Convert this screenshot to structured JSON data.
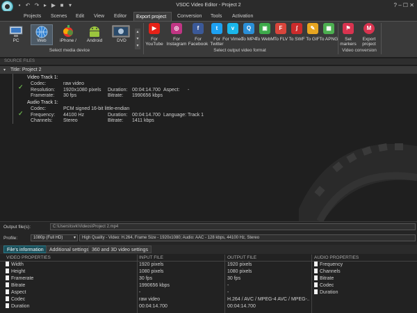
{
  "app": {
    "title": "VSDC Video Editor - Project 2",
    "window_controls": "?  –  ☐  ✕"
  },
  "menu": [
    {
      "label": "Projects"
    },
    {
      "label": "Scenes"
    },
    {
      "label": "Edit"
    },
    {
      "label": "View"
    },
    {
      "label": "Editor"
    },
    {
      "label": "Export project"
    },
    {
      "label": "Conversion"
    },
    {
      "label": "Tools"
    },
    {
      "label": "Activation"
    }
  ],
  "devices": [
    {
      "label": "PC",
      "icon": "pc-icon"
    },
    {
      "label": "Web",
      "icon": "globe-icon"
    },
    {
      "label": "iPhone /",
      "icon": "apple-icon"
    },
    {
      "label": "Android",
      "icon": "android-icon"
    },
    {
      "label": "DVD",
      "icon": "dvd-icon"
    }
  ],
  "device_group_label": "Select media device",
  "formats": [
    {
      "label": "For YouTube",
      "icon": "youtube-icon",
      "color": "#e62117",
      "glyph": "▶"
    },
    {
      "label": "For Instagram",
      "icon": "instagram-icon",
      "color": "#c13584",
      "glyph": "◎"
    },
    {
      "label": "For Facebook",
      "icon": "facebook-icon",
      "color": "#3b5998",
      "glyph": "f"
    },
    {
      "label": "For Twitter",
      "icon": "twitter-icon",
      "color": "#1da1f2",
      "glyph": "t"
    },
    {
      "label": "For Vimeo",
      "icon": "vimeo-icon",
      "color": "#1ab7ea",
      "glyph": "v"
    },
    {
      "label": "To MP4",
      "icon": "mp4-icon",
      "color": "#2a8fd8",
      "glyph": "Q"
    },
    {
      "label": "To WebM",
      "icon": "webm-icon",
      "color": "#3daa4a",
      "glyph": "▣"
    },
    {
      "label": "To FLV",
      "icon": "flv-icon",
      "color": "#d9453b",
      "glyph": "F"
    },
    {
      "label": "To SWF",
      "icon": "swf-icon",
      "color": "#cc2b2b",
      "glyph": "ʃ"
    },
    {
      "label": "To GIF",
      "icon": "gif-icon",
      "color": "#e6a521",
      "glyph": "✎"
    },
    {
      "label": "To APNG",
      "icon": "apng-icon",
      "color": "#4caf50",
      "glyph": "▦"
    }
  ],
  "format_group_label": "Select output video format",
  "conversion": [
    {
      "label": "Set markers",
      "icon": "flag-icon",
      "color": "#d9334f",
      "glyph": "⚑"
    },
    {
      "label": "Export project",
      "icon": "export-icon",
      "color": "#d9334f",
      "glyph": "M"
    }
  ],
  "conversion_group_label": "Video conversion",
  "source": {
    "header": "SOURCE FILES",
    "root": "Title: Project 2",
    "video_track_title": "Video Track 1:",
    "audio_track_title": "Audio Track 1:",
    "video": {
      "codec_label": "Codec:",
      "codec": "raw video",
      "resolution_label": "Resolution:",
      "resolution": "1920x1080 pixels",
      "framerate_label": "Framerate:",
      "framerate": "30 fps",
      "duration_label": "Duration:",
      "duration": "00:04:14.700",
      "bitrate_label": "Bitrate:",
      "bitrate": "1990656 kbps",
      "aspect_label": "Aspect:",
      "aspect": "-"
    },
    "audio": {
      "codec_label": "Codec:",
      "codec": "PCM signed 16-bit little-endian",
      "frequency_label": "Frequency:",
      "frequency": "44100 Hz",
      "channels_label": "Channels:",
      "channels": "Stereo",
      "duration_label": "Duration:",
      "duration": "00:04:14.700",
      "bitrate_label": "Bitrate:",
      "bitrate": "1411 kbps",
      "language_label": "Language:",
      "language": "Track 1"
    }
  },
  "output": {
    "file_label": "Output file(s):",
    "file_value": "C:\\Users\\tsvk\\Videos\\Project 2.mp4",
    "profile_label": "Profile:",
    "profile_value": "1080p (Full HD)",
    "profile_desc": "High Quality - Video: H.264, Frame Size - 1920x1080; Audio: AAC - 128 kbps, 44100 Hz, Stereo"
  },
  "tabs": [
    "File's information",
    "Additional settings",
    "360 and 3D video settings"
  ],
  "table": {
    "headers": [
      "VIDEO PROPERTIES",
      "INPUT FILE",
      "OUTPUT FILE",
      "AUDIO PROPERTIES"
    ],
    "rows": [
      {
        "prop": "Width",
        "input": "1920 pixels",
        "output": "1920 pixels"
      },
      {
        "prop": "Height",
        "input": "1080 pixels",
        "output": "1080 pixels"
      },
      {
        "prop": "Framerate",
        "input": "30 fps",
        "output": "30 fps"
      },
      {
        "prop": "Bitrate",
        "input": "1990656 kbps",
        "output": "-"
      },
      {
        "prop": "Aspect",
        "input": "-",
        "output": "-"
      },
      {
        "prop": "Codec",
        "input": "raw video",
        "output": "H.264 / AVC / MPEG-4 AVC / MPEG-..."
      },
      {
        "prop": "Duration",
        "input": "00:04:14.700",
        "output": "00:04:14.700"
      }
    ],
    "audio_props": [
      "Frequency",
      "Channels",
      "Bitrate",
      "Codec",
      "Duration"
    ]
  }
}
